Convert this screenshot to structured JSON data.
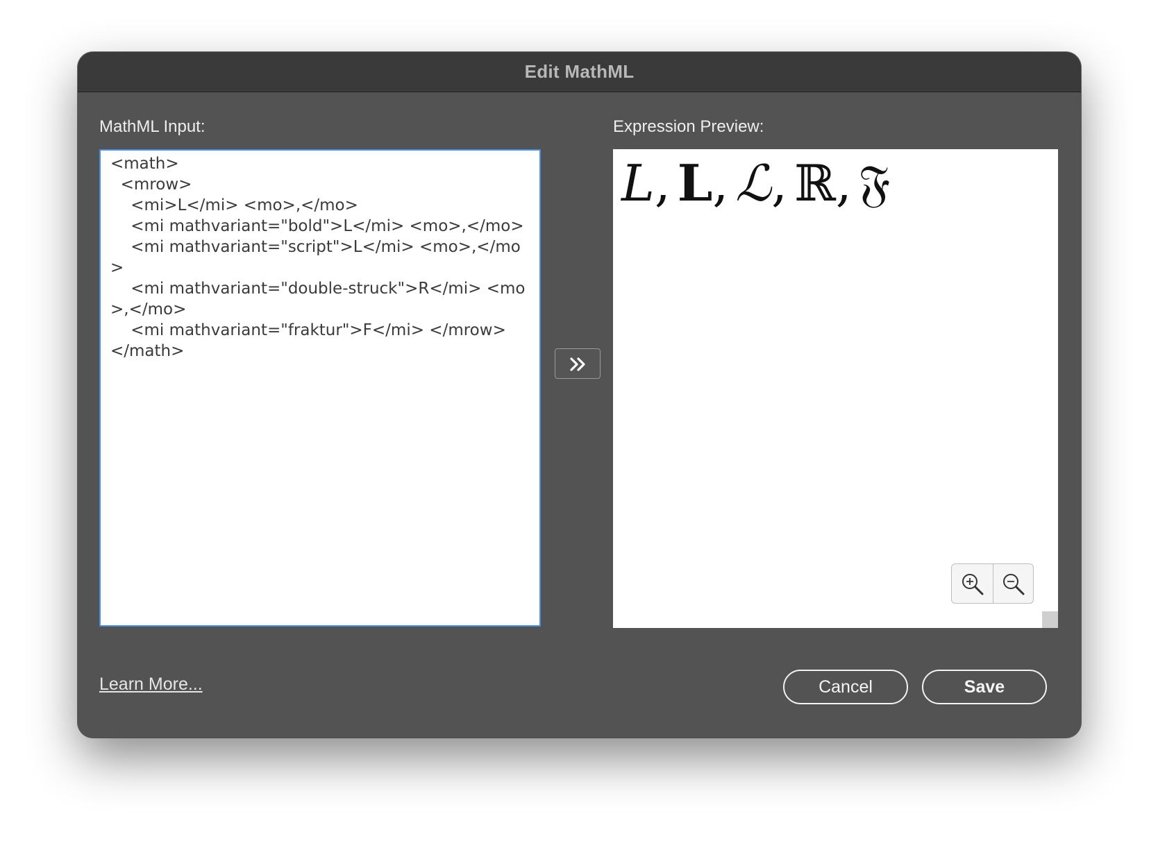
{
  "dialog": {
    "title": "Edit MathML"
  },
  "input_panel": {
    "label": "MathML Input:",
    "text": "<math>\n  <mrow>\n    <mi>L</mi> <mo>,</mo>\n    <mi mathvariant=\"bold\">L</mi> <mo>,</mo>\n    <mi mathvariant=\"script\">L</mi> <mo>,</mo>\n    <mi mathvariant=\"double-struck\">R</mi> <mo>,</mo>\n    <mi mathvariant=\"fraktur\">F</mi> </mrow>\n</math>"
  },
  "convert_button": {
    "icon": "double-chevron-right-icon"
  },
  "preview_panel": {
    "label": "Expression Preview:",
    "symbols": {
      "italic_l": "L",
      "bold_l": "L",
      "script_l": "ℒ",
      "double_struck_r": "ℝ",
      "fraktur_f": "𝔉",
      "comma": ","
    },
    "zoom_in_icon": "zoom-in-icon",
    "zoom_out_icon": "zoom-out-icon"
  },
  "footer": {
    "learn_more": "Learn More...",
    "cancel": "Cancel",
    "save": "Save"
  },
  "colors": {
    "dialog_bg": "#535353",
    "titlebar_bg": "#3a3a3a",
    "focus_border": "#4a90e2"
  }
}
